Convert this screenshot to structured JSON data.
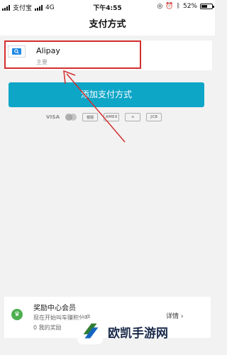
{
  "status_bar": {
    "carrier": "支付宝",
    "network": "4G",
    "time": "下午4:55",
    "battery": "52%"
  },
  "header": {
    "title": "支付方式"
  },
  "payment_method": {
    "name": "Alipay",
    "subtitle": "主要",
    "icon": "alipay-logo-icon"
  },
  "add_button": {
    "label": "添加支付方式"
  },
  "card_brands": [
    "VISA",
    "mastercard",
    "UnionPay",
    "AMERICAN EXPRESS",
    "DISCOVER",
    "JCB"
  ],
  "rewards": {
    "title": "奖励中心会员",
    "line1": "现在开始叫车赚积分吧",
    "line2": "0 我的奖励",
    "link": "详情 ›"
  },
  "watermark": {
    "text": "欧凯手游网"
  },
  "colors": {
    "accent": "#0ea6c7",
    "highlight": "#d32f2f",
    "reward_green": "#4caf50"
  }
}
